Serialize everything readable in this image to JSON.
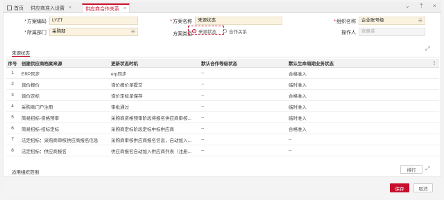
{
  "tabs": [
    {
      "label": "首页"
    },
    {
      "label": "供应商准入设置"
    },
    {
      "label": "供应商合作关系"
    }
  ],
  "tab_close": "×",
  "form": {
    "plan_code": {
      "label": "方案编码",
      "value": "LYZT"
    },
    "plan_name": {
      "label": "方案名称",
      "value": "来源状态"
    },
    "org_name": {
      "label": "组织名称",
      "value": "企业账号级"
    },
    "dept": {
      "label": "所属部门",
      "value": "采购部"
    },
    "plan_type": {
      "label": "方案类型",
      "options": [
        "来源状态",
        "合作关系"
      ],
      "selected": "来源状态"
    },
    "operator": {
      "label": "操作人",
      "placeholder": "张惠菲"
    }
  },
  "section": {
    "title": "来源状态"
  },
  "table": {
    "columns": [
      "序号",
      "创建供应商档案来源",
      "更新状态时机",
      "默认合作等级状态",
      "默认生命周期业务状态"
    ],
    "rows": [
      [
        "1",
        "ERP同步",
        "erp同步",
        "--",
        "合格准入"
      ],
      [
        "2",
        "询价报价",
        "询价报价单提交",
        "--",
        "临时准入"
      ],
      [
        "3",
        "询价定标",
        "询价定标单保存",
        "--",
        "合格准入"
      ],
      [
        "4",
        "采购商门户注册",
        "审批通过",
        "--",
        "临时准入"
      ],
      [
        "5",
        "简易招标-资格预审",
        "采购商资格预审阶段将报名供应商审核...",
        "--",
        "临时准入"
      ],
      [
        "6",
        "简易招标-招标定标",
        "采购商定标阶段定标中标供应商",
        "--",
        "合格准入"
      ],
      [
        "7",
        "法定招标：采购商审核供应商报名信息",
        "采购商审核供应商报名信息，自动加入...",
        "--",
        "--"
      ],
      [
        "8",
        "法定招标：供应商报名",
        "供应商报名自动加入供应商列表（注册...",
        "--",
        "--"
      ]
    ]
  },
  "subsection": {
    "title": "适用组织范围",
    "sort_label": "排行"
  },
  "footer": {
    "save_label": "保存",
    "cancel_label": "取消"
  },
  "colors": {
    "accent": "#c8102e",
    "field_bg": "#fbf3df"
  }
}
